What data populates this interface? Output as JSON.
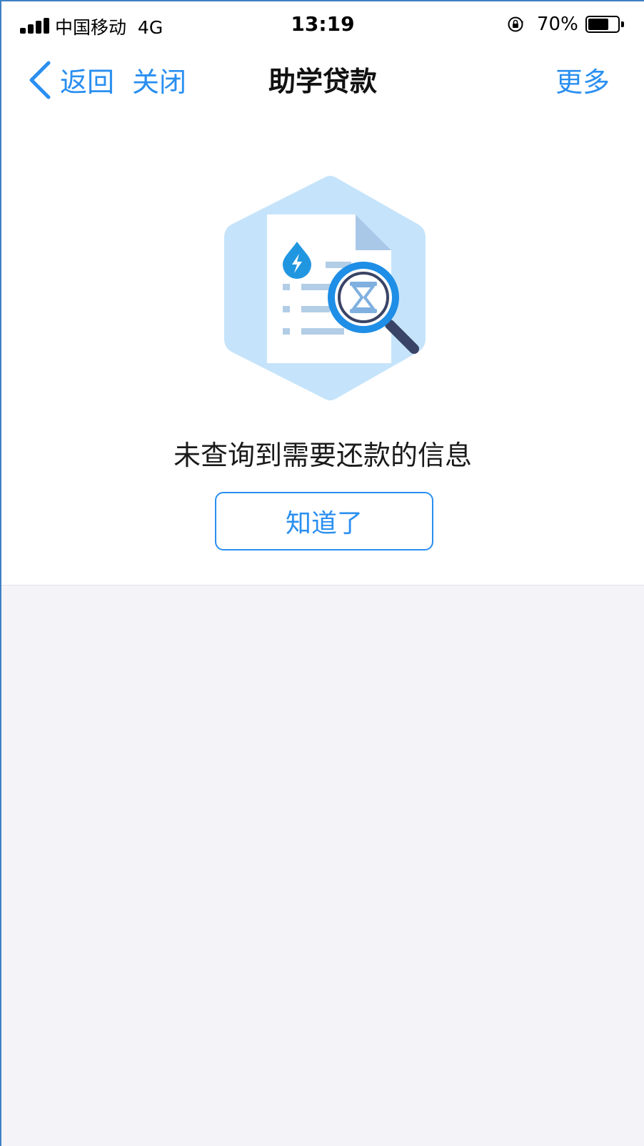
{
  "status_bar": {
    "carrier": "中国移动",
    "network": "4G",
    "time": "13:19",
    "battery_percent": "70%",
    "battery_level": 0.7,
    "lock_icon": "rotation-lock-icon"
  },
  "nav": {
    "back_label": "返回",
    "close_label": "关闭",
    "title": "助学贷款",
    "more_label": "更多",
    "back_icon": "chevron-left-icon"
  },
  "content": {
    "illustration_icon": "document-search-icon",
    "empty_message": "未查询到需要还款的信息",
    "ack_button_label": "知道了"
  },
  "colors": {
    "accent": "#2a8ff0",
    "page_background": "#f3f3f8",
    "hexagon_background": "#c5e4fb",
    "magnifier_ring": "#1e8ee6",
    "droplet": "#2196e0",
    "text_lines": "#b2cde6"
  }
}
